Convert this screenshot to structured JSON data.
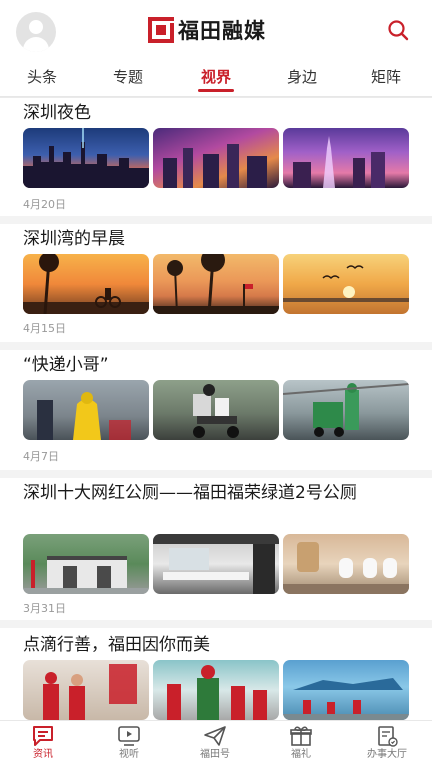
{
  "header": {
    "title": "福田融媒",
    "logo_color": "#c9202a"
  },
  "tabs": [
    {
      "label": "头条",
      "active": false
    },
    {
      "label": "专题",
      "active": false
    },
    {
      "label": "视界",
      "active": true
    },
    {
      "label": "身边",
      "active": false
    },
    {
      "label": "矩阵",
      "active": false
    }
  ],
  "articles": [
    {
      "title": "深圳夜色",
      "date": "4月20日",
      "thumbs": [
        "city-night-skyline-photo",
        "city-night-aerial-photo",
        "city-night-purple-tower-photo"
      ]
    },
    {
      "title": "深圳湾的早晨",
      "date": "4月15日",
      "thumbs": [
        "sunrise-cyclists-palms-photo",
        "sunrise-palm-trees-flags-photo",
        "sunrise-birds-bay-photo"
      ]
    },
    {
      "title": "“快递小哥”",
      "date": "4月7日",
      "thumbs": [
        "courier-yellow-raincoat-photo",
        "courier-scooter-photo",
        "courier-green-cart-photo"
      ]
    },
    {
      "title": "深圳十大网红公厕——福田福荣绿道2号公厕",
      "date": "3月31日",
      "thumbs": [
        "public-toilet-exterior-photo",
        "public-toilet-sinks-photo",
        "public-toilet-interior-photo"
      ]
    },
    {
      "title": "点滴行善，福田因你而美",
      "date": "",
      "thumbs": [
        "volunteers-salute-photo",
        "volunteers-red-vests-photo",
        "volunteers-riverside-photo"
      ]
    }
  ],
  "bottom_nav": [
    {
      "label": "资讯",
      "icon": "news-icon",
      "active": true
    },
    {
      "label": "视听",
      "icon": "tv-icon",
      "active": false
    },
    {
      "label": "福田号",
      "icon": "paper-plane-icon",
      "active": false
    },
    {
      "label": "福礼",
      "icon": "gift-icon",
      "active": false
    },
    {
      "label": "办事大厅",
      "icon": "service-hall-icon",
      "active": false
    }
  ],
  "colors": {
    "accent": "#c9202a",
    "date_text": "#999999",
    "inactive_nav": "#777777"
  }
}
